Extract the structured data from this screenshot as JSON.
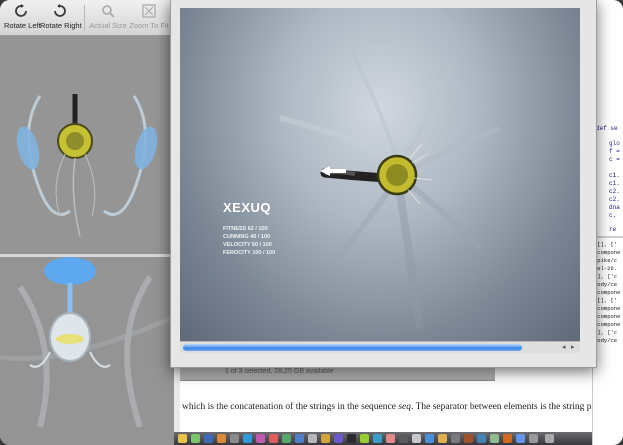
{
  "preview": {
    "toolbar": {
      "rotate_left": "Rotate Left",
      "rotate_right": "Rotate Right",
      "actual_size": "Actual Size",
      "zoom_to_fit": "Zoom To Fit"
    }
  },
  "game": {
    "creature_name": "XEXUQ",
    "stats": {
      "fitness": "FITNESS 62 / 100",
      "cunning": "CUNNING 40 / 100",
      "velocity": "VELOCITY 50 / 100",
      "ferocity": "FEROCITY 100 / 100"
    }
  },
  "code_editor": {
    "lines": [
      "def se",
      "glo",
      "f =",
      "c =",
      "c1.",
      "c1.",
      "c2.",
      "c2.",
      "dna",
      "c.",
      "re"
    ]
  },
  "output": {
    "lines": [
      "([], ['",
      "'compone",
      "spike/c",
      "cel-26.",
      "[], ['c",
      "body/ce",
      "'compone",
      "[[], ['",
      "'compone",
      "'compone",
      "'compone",
      "[], ['c",
      "body/ce"
    ]
  },
  "document": {
    "status": "1 of 3 selected, 28,25 GB available",
    "body_before": "which is the concatenation of the strings in the sequence ",
    "body_code": "seq",
    "body_after": ". The separator between elements is the string providing this metho"
  },
  "colors": {
    "accent": "#3b86e6",
    "canvas_top": "#d0d7df",
    "canvas_bottom": "#5f6a78"
  }
}
